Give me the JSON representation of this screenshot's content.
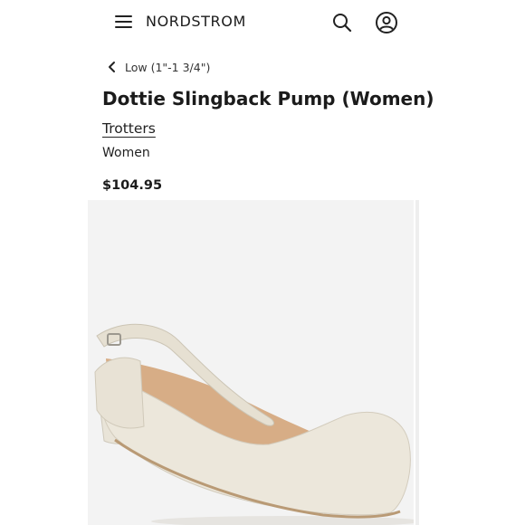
{
  "header": {
    "brand": "NORDSTROM",
    "menu_icon": "hamburger-menu-icon",
    "search_icon": "search-icon",
    "account_icon": "account-icon"
  },
  "breadcrumb": {
    "back_label": "Low (1\"-1 3/4\")",
    "icon": "chevron-left-icon"
  },
  "product": {
    "title": "Dottie Slingback Pump (Women)",
    "brand": "Trotters",
    "category": "Women",
    "price": "$104.95"
  },
  "gallery": {
    "image_alt": "Dottie Slingback Pump in cream leather, side view",
    "colors": {
      "background": "#f3f3f3",
      "shoe": "#ece7db",
      "lining": "#d7ad86"
    }
  }
}
